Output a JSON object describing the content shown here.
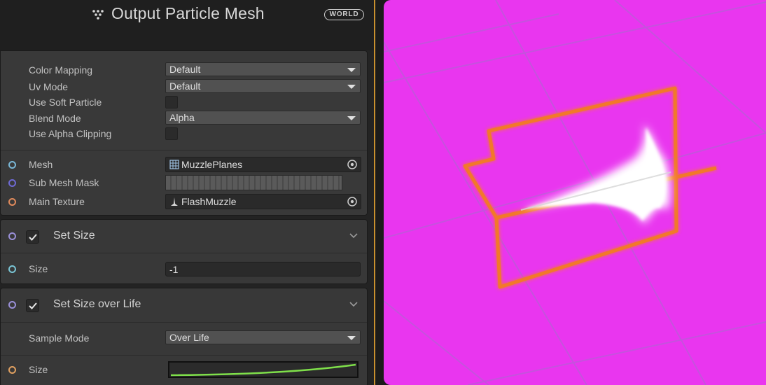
{
  "node": {
    "title": "Output Particle Mesh",
    "space_badge": "WORLD"
  },
  "properties": {
    "color_mapping": {
      "label": "Color Mapping",
      "value": "Default"
    },
    "uv_mode": {
      "label": "Uv Mode",
      "value": "Default"
    },
    "use_soft_particle": {
      "label": "Use Soft Particle",
      "checked": false
    },
    "blend_mode": {
      "label": "Blend Mode",
      "value": "Alpha"
    },
    "use_alpha_clipping": {
      "label": "Use Alpha Clipping",
      "checked": false
    },
    "mesh": {
      "label": "Mesh",
      "value": "MuzzlePlanes"
    },
    "sub_mesh_mask": {
      "label": "Sub Mesh Mask"
    },
    "main_texture": {
      "label": "Main Texture",
      "value": "FlashMuzzle"
    }
  },
  "set_size": {
    "title": "Set Size",
    "enabled": true,
    "size_label": "Size",
    "size_value": "-1"
  },
  "set_size_over_life": {
    "title": "Set Size over Life",
    "enabled": true,
    "sample_mode_label": "Sample Mode",
    "sample_mode_value": "Over Life",
    "size_label": "Size"
  },
  "colors": {
    "viewport_background": "#e936ef",
    "outline": "#f2782a",
    "curve": "#7fe04a",
    "accent": "#f0b030"
  }
}
